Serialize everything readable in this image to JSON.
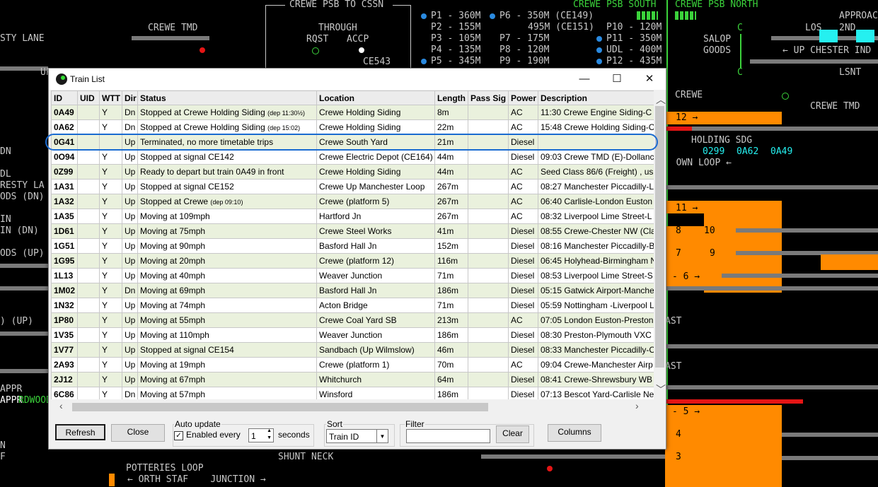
{
  "background": {
    "labels": [
      {
        "name": "label-sty-lane",
        "text": "STY LANE"
      },
      {
        "name": "label-crewe-tmd-left",
        "text": "CREWE TMD"
      },
      {
        "name": "label-crewe-psb-to-cssn",
        "text": "CREWE PSB TO CSSN"
      },
      {
        "name": "label-through",
        "text": "THROUGH"
      },
      {
        "name": "label-rqst",
        "text": "RQST"
      },
      {
        "name": "label-accp",
        "text": "ACCP"
      },
      {
        "name": "label-ce543",
        "text": "CE543"
      },
      {
        "name": "label-crewe-psb-south",
        "text": "CREWE PSB SOUTH"
      },
      {
        "name": "label-crewe-psb-north",
        "text": "CREWE PSB NORTH"
      },
      {
        "name": "label-approach",
        "text": "APPROAC"
      },
      {
        "name": "label-salop",
        "text": "SALOP"
      },
      {
        "name": "label-goods",
        "text": "GOODS"
      },
      {
        "name": "label-los",
        "text": "LOS"
      },
      {
        "name": "label-2nd",
        "text": "2ND"
      },
      {
        "name": "label-up-chester-ind",
        "text": "UP CHESTER IND"
      },
      {
        "name": "label-lsnt",
        "text": "LSNT"
      },
      {
        "name": "label-crewe-right",
        "text": "CREWE"
      },
      {
        "name": "label-crewe-tmd-right",
        "text": "CREWE TMD"
      },
      {
        "name": "label-holding-sdg",
        "text": "HOLDING SDG"
      },
      {
        "name": "label-own-loop",
        "text": "OWN LOOP"
      },
      {
        "name": "label-potteries-loop",
        "text": "POTTERIES LOOP"
      },
      {
        "name": "label-shunt-neck",
        "text": "SHUNT NECK"
      },
      {
        "name": "label-up",
        "text": "UP"
      },
      {
        "name": "label-dn",
        "text": "DN"
      },
      {
        "name": "label-dl",
        "text": "DL"
      },
      {
        "name": "label-esty-la",
        "text": "RESTY LA"
      },
      {
        "name": "label-ods-dn",
        "text": "ODS (DN)"
      },
      {
        "name": "label-in",
        "text": "IN"
      },
      {
        "name": "label-in-dn",
        "text": "IN (DN)"
      },
      {
        "name": "label-ods-up",
        "text": "ODS (UP)"
      },
      {
        "name": "label-up-paren",
        "text": ") (UP)"
      },
      {
        "name": "label-appr-1",
        "text": "APPR"
      },
      {
        "name": "label-appr-2",
        "text": "APPR"
      },
      {
        "name": "label-rdwood-gf",
        "text": "RDWOOD GF"
      },
      {
        "name": "label-n",
        "text": "N"
      },
      {
        "name": "label-f",
        "text": "F"
      },
      {
        "name": "label-orth-staf",
        "text": "ORTH STAF"
      },
      {
        "name": "label-junction",
        "text": "JUNCTION"
      },
      {
        "name": "label-ast-1",
        "text": "AST"
      },
      {
        "name": "label-ast-2",
        "text": "AST"
      },
      {
        "name": "label-c-top",
        "text": "C"
      },
      {
        "name": "label-c-bottom",
        "text": "C"
      }
    ],
    "platforms": [
      {
        "name": "platform-p1",
        "text": "P1 - 360M"
      },
      {
        "name": "platform-p6",
        "text": "P6 - 350M (CE149)"
      },
      {
        "name": "platform-p2",
        "text": "P2 - 155M"
      },
      {
        "name": "platform-495",
        "text": "495M (CE151)"
      },
      {
        "name": "platform-p10",
        "text": "P10 - 120M"
      },
      {
        "name": "platform-p3",
        "text": "P3 - 105M"
      },
      {
        "name": "platform-p7",
        "text": "P7 - 175M"
      },
      {
        "name": "platform-p11",
        "text": "P11 - 350M"
      },
      {
        "name": "platform-p4",
        "text": "P4 - 135M"
      },
      {
        "name": "platform-p8",
        "text": "P8 - 120M"
      },
      {
        "name": "platform-udl",
        "text": "UDL - 400M"
      },
      {
        "name": "platform-p5",
        "text": "P5 - 345M"
      },
      {
        "name": "platform-p9",
        "text": "P9 - 190M"
      },
      {
        "name": "platform-p12",
        "text": "P12 - 435M"
      }
    ],
    "berths": [
      "0299",
      "0A62",
      "0A49"
    ],
    "track_numbers": [
      "12",
      "11",
      "8",
      "10",
      "7",
      "9",
      "6",
      "5",
      "4",
      "3"
    ]
  },
  "window": {
    "title": "Train List",
    "minimize": "—",
    "maximize": "☐",
    "close": "✕"
  },
  "table": {
    "columns": [
      "ID",
      "UID",
      "WTT",
      "Dir",
      "Status",
      "Location",
      "Length",
      "Pass Sig",
      "Power",
      "Description"
    ],
    "rows": [
      {
        "id": "0A49",
        "uid": "",
        "wtt": "Y",
        "dir": "Dn",
        "status": "Stopped at Crewe Holding Siding",
        "status_note": "(dep 11:30½)",
        "location": "Crewe Holding Siding",
        "length": "8m",
        "pass_sig": "",
        "power": "AC",
        "description": "11:30 Crewe Engine Siding-C"
      },
      {
        "id": "0A62",
        "uid": "",
        "wtt": "Y",
        "dir": "Dn",
        "status": "Stopped at Crewe Holding Siding",
        "status_note": "(dep 15:02)",
        "location": "Crewe Holding Siding",
        "length": "22m",
        "pass_sig": "",
        "power": "AC",
        "description": "15:48 Crewe Holding Siding-C"
      },
      {
        "id": "0G41",
        "uid": "",
        "wtt": "",
        "dir": "Up",
        "status": "Terminated, no more timetable trips",
        "status_note": "",
        "location": "Crewe South Yard",
        "length": "21m",
        "pass_sig": "",
        "power": "Diesel",
        "description": ""
      },
      {
        "id": "0O94",
        "uid": "",
        "wtt": "Y",
        "dir": "Up",
        "status": "Stopped at signal CE142",
        "status_note": "",
        "location": "Crewe Electric Depot (CE164)",
        "length": "44m",
        "pass_sig": "",
        "power": "Diesel",
        "description": "09:03 Crewe TMD (E)-Dollanc"
      },
      {
        "id": "0Z99",
        "uid": "",
        "wtt": "Y",
        "dir": "Up",
        "status": "Ready to depart but train 0A49 in front",
        "status_note": "",
        "location": "Crewe Holding Siding",
        "length": "44m",
        "pass_sig": "",
        "power": "AC",
        "description": "Seed Class 86/6 (Freight) , us"
      },
      {
        "id": "1A31",
        "uid": "",
        "wtt": "Y",
        "dir": "Up",
        "status": "Stopped at signal CE152",
        "status_note": "",
        "location": "Crewe Up Manchester Loop",
        "length": "267m",
        "pass_sig": "",
        "power": "AC",
        "description": "08:27 Manchester Piccadilly-L"
      },
      {
        "id": "1A32",
        "uid": "",
        "wtt": "Y",
        "dir": "Up",
        "status": "Stopped at Crewe",
        "status_note": "(dep 09:10)",
        "location": "Crewe (platform 5)",
        "length": "267m",
        "pass_sig": "",
        "power": "AC",
        "description": "06:40 Carlisle-London Euston"
      },
      {
        "id": "1A35",
        "uid": "",
        "wtt": "Y",
        "dir": "Up",
        "status": "Moving at 109mph",
        "status_note": "",
        "location": "Hartford Jn",
        "length": "267m",
        "pass_sig": "",
        "power": "AC",
        "description": "08:32 Liverpool Lime Street-L"
      },
      {
        "id": "1D61",
        "uid": "",
        "wtt": "Y",
        "dir": "Up",
        "status": "Moving at 75mph",
        "status_note": "",
        "location": "Crewe Steel Works",
        "length": "41m",
        "pass_sig": "",
        "power": "Diesel",
        "description": "08:55 Crewe-Chester NW (Cla"
      },
      {
        "id": "1G51",
        "uid": "",
        "wtt": "Y",
        "dir": "Up",
        "status": "Moving at 90mph",
        "status_note": "",
        "location": "Basford Hall Jn",
        "length": "152m",
        "pass_sig": "",
        "power": "Diesel",
        "description": "08:16 Manchester Piccadilly-B"
      },
      {
        "id": "1G95",
        "uid": "",
        "wtt": "Y",
        "dir": "Up",
        "status": "Moving at 20mph",
        "status_note": "",
        "location": "Crewe (platform 12)",
        "length": "116m",
        "pass_sig": "",
        "power": "Diesel",
        "description": "06:45 Holyhead-Birmingham N"
      },
      {
        "id": "1L13",
        "uid": "",
        "wtt": "Y",
        "dir": "Up",
        "status": "Moving at 40mph",
        "status_note": "",
        "location": "Weaver Junction",
        "length": "71m",
        "pass_sig": "",
        "power": "Diesel",
        "description": "08:53 Liverpool Lime Street-S"
      },
      {
        "id": "1M02",
        "uid": "",
        "wtt": "Y",
        "dir": "Dn",
        "status": "Moving at 69mph",
        "status_note": "",
        "location": "Basford Hall Jn",
        "length": "186m",
        "pass_sig": "",
        "power": "Diesel",
        "description": "05:15 Gatwick Airport-Manche"
      },
      {
        "id": "1N32",
        "uid": "",
        "wtt": "Y",
        "dir": "Up",
        "status": "Moving at 74mph",
        "status_note": "",
        "location": "Acton Bridge",
        "length": "71m",
        "pass_sig": "",
        "power": "Diesel",
        "description": "05:59 Nottingham -Liverpool L"
      },
      {
        "id": "1P80",
        "uid": "",
        "wtt": "Y",
        "dir": "Up",
        "status": "Moving at 55mph",
        "status_note": "",
        "location": "Crewe Coal Yard SB",
        "length": "213m",
        "pass_sig": "",
        "power": "AC",
        "description": "07:05 London Euston-Preston"
      },
      {
        "id": "1V35",
        "uid": "",
        "wtt": "Y",
        "dir": "Up",
        "status": "Moving at 110mph",
        "status_note": "",
        "location": "Weaver Junction",
        "length": "186m",
        "pass_sig": "",
        "power": "Diesel",
        "description": "08:30 Preston-Plymouth VXC"
      },
      {
        "id": "1V77",
        "uid": "",
        "wtt": "Y",
        "dir": "Up",
        "status": "Stopped at signal CE154",
        "status_note": "",
        "location": "Sandbach (Up Wilmslow)",
        "length": "46m",
        "pass_sig": "",
        "power": "Diesel",
        "description": "08:33 Manchester Piccadilly-C"
      },
      {
        "id": "2A93",
        "uid": "",
        "wtt": "Y",
        "dir": "Up",
        "status": "Moving at 19mph",
        "status_note": "",
        "location": "Crewe (platform 1)",
        "length": "70m",
        "pass_sig": "",
        "power": "AC",
        "description": "09:04 Crewe-Manchester Airp"
      },
      {
        "id": "2J12",
        "uid": "",
        "wtt": "Y",
        "dir": "Up",
        "status": "Moving at 67mph",
        "status_note": "",
        "location": "Whitchurch",
        "length": "64m",
        "pass_sig": "",
        "power": "Diesel",
        "description": "08:41 Crewe-Shrewsbury WB"
      },
      {
        "id": "6C86",
        "uid": "",
        "wtt": "Y",
        "dir": "Dn",
        "status": "Moving at 57mph",
        "status_note": "",
        "location": "Winsford",
        "length": "186m",
        "pass_sig": "",
        "power": "Diesel",
        "description": "07:13 Bescot Yard-Carlisle Ne"
      }
    ]
  },
  "controls": {
    "refresh": "Refresh",
    "close": "Close",
    "auto_update_label": "Auto update",
    "enabled_every": "Enabled every",
    "enabled_checked": "✓",
    "interval": "1",
    "seconds": "seconds",
    "sort_label": "Sort",
    "sort_value": "Train ID",
    "filter_label": "Filter",
    "filter_value": "",
    "clear": "Clear",
    "columns": "Columns"
  },
  "colors": {
    "highlight": "#1a6bd1",
    "row_alt": "#eaf1dd",
    "track": "#7a7a7a",
    "occupied": "#ff8a00",
    "signal_red": "#e51515",
    "label_green": "#3bd23b",
    "berth_cyan": "#25f0f0"
  }
}
